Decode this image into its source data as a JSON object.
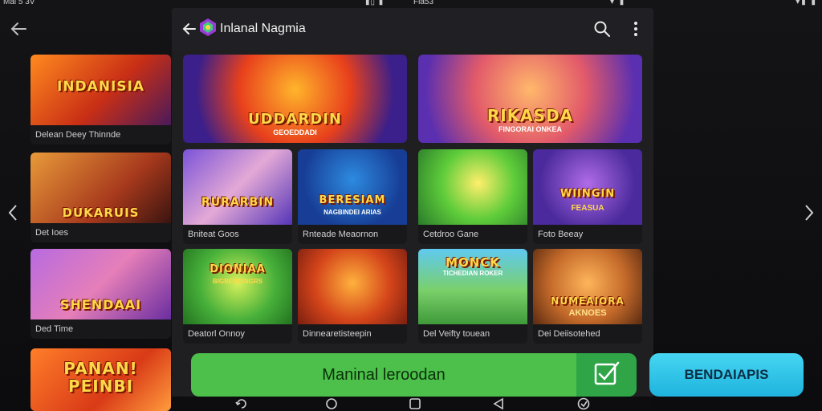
{
  "status_bar": {
    "left_text": "Mai 5 3V",
    "center_text": "Fla53",
    "icons": [
      "signal-icon",
      "wifi-icon",
      "battery-icon"
    ]
  },
  "dialog": {
    "title": "Inlanal Nagmia",
    "icons": {
      "back": "back-arrow-icon",
      "logo": "gem-logo-icon",
      "search": "search-icon",
      "menu": "overflow-menu-icon"
    }
  },
  "background_cards": [
    {
      "banner": "INDANISIA",
      "caption": "Delean Deey Thinnde"
    },
    {
      "banner": "DUKARUIS",
      "caption": "Det Ioes"
    },
    {
      "banner": "SHENDAAI",
      "caption": "Ded Time"
    },
    {
      "banner": "PANAN! PEINBI",
      "caption": ""
    }
  ],
  "featured": [
    {
      "banner": "UDDARDIN",
      "sub": "GEOEDDADI",
      "caption": ""
    },
    {
      "banner": "RIKASDA",
      "sub": "FINGORAI ONKEA",
      "caption": ""
    }
  ],
  "games": [
    {
      "banner": "RURARBIN",
      "caption": "Bniteat Goos"
    },
    {
      "banner": "BERESIAM",
      "sub": "NAGBINDEI ARIAS",
      "caption": "Rnteade Meaornon"
    },
    {
      "banner": "",
      "caption": "Cetdroo Gane"
    },
    {
      "banner": "WIINGIN",
      "sub": "FEASUA",
      "caption": "Foto Beeay"
    },
    {
      "banner": "DIONIAA",
      "sub": "BIGBENDINGRS",
      "caption": "Deatorl Onnoy"
    },
    {
      "banner": "",
      "caption": "Dinnearetisteepin"
    },
    {
      "banner": "MONCK",
      "sub": "TICHEDIAN ROKER",
      "caption": "Del Veifty touean"
    },
    {
      "banner": "NUMEAIORA",
      "sub": "AKNOES",
      "caption": "Dei Deiisotehed"
    }
  ],
  "primary_button": {
    "label": "Maninal leroodan",
    "icon": "edit-check-icon"
  },
  "secondary_button": {
    "label": "BENDAIAPIS"
  },
  "nav_icons": [
    "rotate-icon",
    "home-circle-icon",
    "recents-square-icon",
    "back-triangle-icon",
    "accessibility-icon"
  ],
  "colors": {
    "primary": "#4cc04a",
    "secondary": "#1fb3de",
    "dialog_bg": "#1f1f22"
  }
}
